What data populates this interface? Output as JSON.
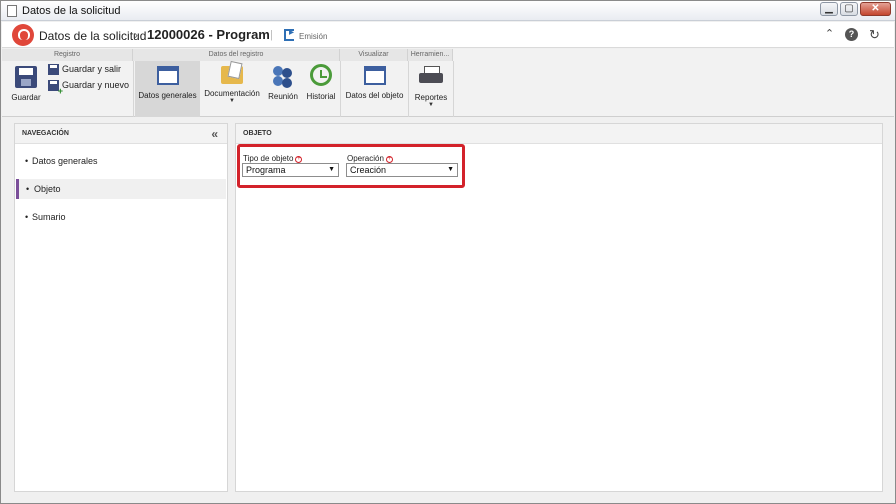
{
  "window": {
    "title": "Datos de la solicitud",
    "controls": {
      "minimize": "▁",
      "maximize": "▢",
      "close": "✕"
    }
  },
  "header": {
    "app_name": "Datos de la solicitud",
    "breadcrumb_sep": "›",
    "record": "12000026 - Program",
    "separator": "|",
    "emission": "Emisión",
    "icons": {
      "collapse": "⌃",
      "help": "?",
      "refresh": "↻"
    }
  },
  "ribbon": {
    "groups": [
      "Registro",
      "Datos del registro",
      "Visualizar",
      "Herramien..."
    ],
    "registro": {
      "save": "Guardar",
      "save_exit": "Guardar y salir",
      "save_new": "Guardar y nuevo"
    },
    "datos": {
      "general": "Datos generales",
      "documentation": "Documentación",
      "meeting": "Reunión",
      "history": "Historial"
    },
    "visualizar": {
      "object_data": "Datos del objeto"
    },
    "herramientas": {
      "reports": "Reportes"
    },
    "dropdown_glyph": "▼"
  },
  "navigation": {
    "title": "NAVEGACIÓN",
    "collapse": "«",
    "bullet": "•",
    "items": [
      {
        "label": "Datos generales",
        "selected": false
      },
      {
        "label": "Objeto",
        "selected": true
      },
      {
        "label": "Sumario",
        "selected": false
      }
    ],
    "accent": "#7b4f9a"
  },
  "main": {
    "title": "OBJETO",
    "required_mark": "+",
    "fields": {
      "object_type": {
        "label": "Tipo de objeto",
        "value": "Programa"
      },
      "operation": {
        "label": "Operación",
        "value": "Creación"
      }
    },
    "select_arrow": "▼",
    "highlight_color": "#d3222a"
  }
}
